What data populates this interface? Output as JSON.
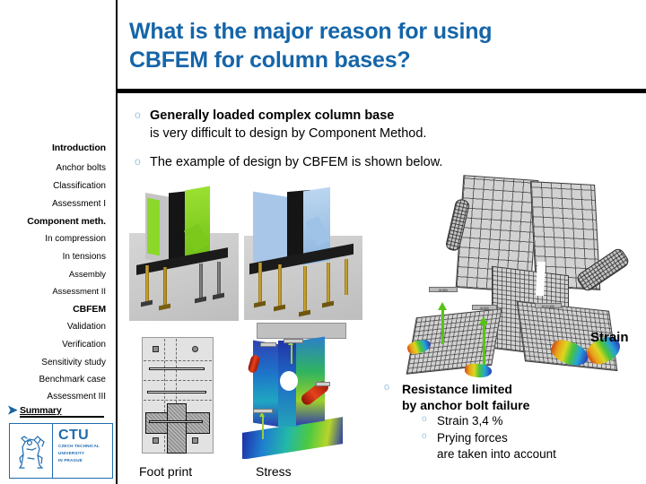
{
  "slide": {
    "title": "What is the major reason for using CBFEM for column bases?",
    "title_lines": [
      "What is the major reason for using",
      "CBFEM for column bases?"
    ],
    "title_color": "#1565A8",
    "rule_color": "#000000",
    "background": "#ffffff"
  },
  "sidebar": {
    "divider_color": "#000000",
    "items": [
      {
        "label": "Introduction",
        "level": 0
      },
      {
        "label": "Anchor bolts",
        "level": 1
      },
      {
        "label": "Classification",
        "level": 1
      },
      {
        "label": "Assessment I",
        "level": 1
      },
      {
        "label": "Component meth.",
        "level": 0
      },
      {
        "label": "In compression",
        "level": 1
      },
      {
        "label": "In tensions",
        "level": 1
      },
      {
        "label": "Assembly",
        "level": 2
      },
      {
        "label": "Assessment II",
        "level": 2
      },
      {
        "label": "CBFEM",
        "level": 0
      },
      {
        "label": "Validation",
        "level": 1
      },
      {
        "label": "Verification",
        "level": 1
      },
      {
        "label": "Sensitivity study",
        "level": 1
      },
      {
        "label": "Benchmark case",
        "level": 1
      },
      {
        "label": "Assessment III",
        "level": 1
      }
    ],
    "summary": {
      "label": "Summary",
      "marker": "chevron-right-icon",
      "marker_color": "#18649E"
    },
    "logo": {
      "abbr": "CTU",
      "sub_lines": [
        "CZECH TECHNICAL",
        "UNIVERSITY",
        "IN PRAGUE"
      ],
      "emblem": "ctu-lion-icon",
      "color": "#1F6BB0"
    }
  },
  "content": {
    "bullet_marker": "hollow-circle-bullet",
    "bullet_color": "#9CC7E4",
    "bullets": [
      {
        "marker": "o",
        "bold_line": "Generally loaded complex column base",
        "normal_line": "is very difficult to design by Component Method."
      },
      {
        "marker": "o",
        "text": "The example of design by CBFEM is shown below."
      }
    ],
    "right_block": {
      "marker": "o",
      "heading_lines": [
        "Resistance limited",
        "by anchor bolt failure"
      ],
      "sub_items": [
        {
          "marker": "o",
          "lines": [
            "Strain 3,4 %"
          ]
        },
        {
          "marker": "o",
          "lines": [
            "Prying forces",
            "are taken into account"
          ]
        }
      ]
    }
  },
  "figures": {
    "model_a": {
      "name": "column-base-3d-green",
      "highlight_color": "#7ED321",
      "bolt_color": "#C8A43A"
    },
    "model_b": {
      "name": "column-base-3d-blue",
      "highlight_color": "#A8C6E8",
      "bolt_color": "#C8A43A"
    },
    "mesh": {
      "name": "fem-mesh-deformed",
      "caption": "Strain",
      "load_tags": [
        "M 550",
        "M 500",
        "M 10 450"
      ],
      "arrow_color": "#57C317"
    },
    "footprint": {
      "name": "base-plate-footprint",
      "caption": "Foot print"
    },
    "stress": {
      "name": "stress-contour-plot",
      "caption": "Stress"
    }
  }
}
